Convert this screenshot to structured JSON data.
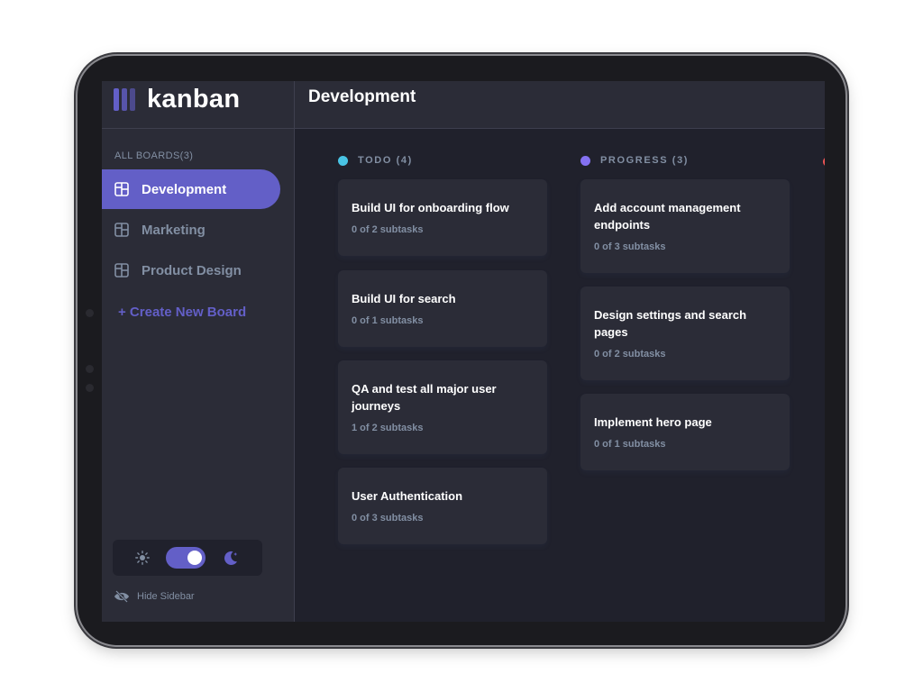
{
  "app": {
    "name": "kanban"
  },
  "header": {
    "board_title": "Development"
  },
  "sidebar": {
    "heading": "ALL BOARDS(3)",
    "boards": [
      {
        "label": "Development",
        "active": true
      },
      {
        "label": "Marketing",
        "active": false
      },
      {
        "label": "Product Design",
        "active": false
      }
    ],
    "create_label": "+ Create New Board",
    "theme": {
      "mode": "dark",
      "light_icon": "sun-icon",
      "dark_icon": "moon-icon"
    },
    "hide_label": "Hide Sidebar"
  },
  "columns": [
    {
      "title": "TODO (4)",
      "dot_color": "#49c4e5",
      "cards": [
        {
          "title": "Build UI for onboarding flow",
          "subtasks": "0 of 2 subtasks"
        },
        {
          "title": "Build UI for search",
          "subtasks": "0 of 1 subtasks"
        },
        {
          "title": "QA and test all major user journeys",
          "subtasks": "1 of 2 subtasks"
        },
        {
          "title": "User Authentication",
          "subtasks": "0 of 3 subtasks"
        }
      ]
    },
    {
      "title": "PROGRESS (3)",
      "dot_color": "#8471f2",
      "cards": [
        {
          "title": "Add account management endpoints",
          "subtasks": "0 of 3 subtasks"
        },
        {
          "title": "Design settings and search pages",
          "subtasks": "0 of 2 subtasks"
        },
        {
          "title": "Implement hero page",
          "subtasks": "0 of 1 subtasks"
        }
      ]
    }
  ],
  "colors": {
    "accent": "#635fc7",
    "background": "#20212c",
    "surface": "#2b2c37",
    "muted_text": "#828fa3",
    "next_column_dot": "#ea5555"
  }
}
